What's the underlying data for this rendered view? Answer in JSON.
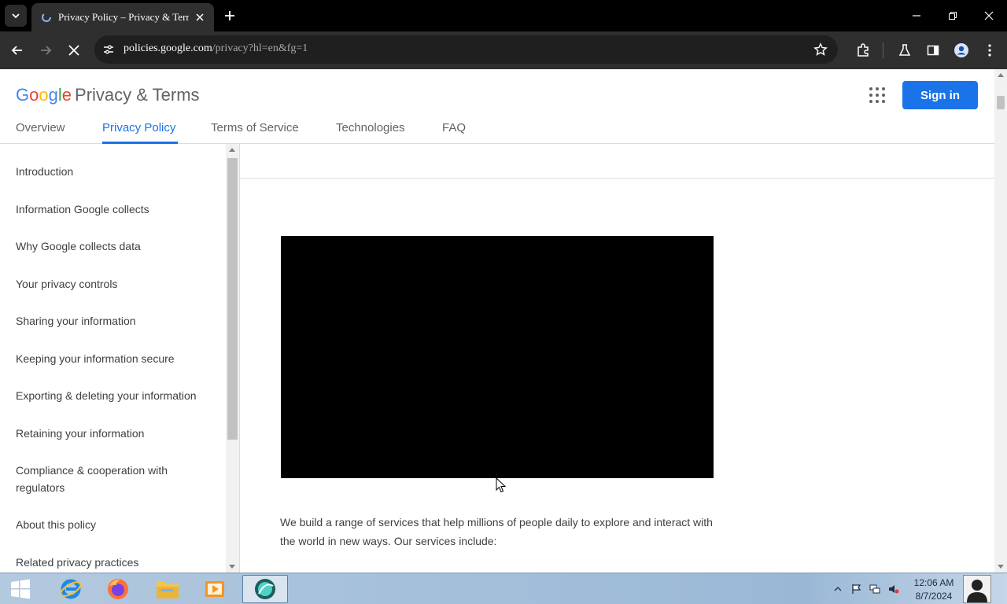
{
  "browser": {
    "tab_title": "Privacy Policy – Privacy & Terms – Google",
    "url_domain": "policies.google.com",
    "url_path": "/privacy?hl=en&fg=1"
  },
  "header": {
    "logo_letters": [
      "G",
      "o",
      "o",
      "g",
      "l",
      "e"
    ],
    "site_title": "Privacy & Terms",
    "sign_in_label": "Sign in",
    "nav_tabs": [
      {
        "label": "Overview",
        "active": false
      },
      {
        "label": "Privacy Policy",
        "active": true
      },
      {
        "label": "Terms of Service",
        "active": false
      },
      {
        "label": "Technologies",
        "active": false
      },
      {
        "label": "FAQ",
        "active": false
      }
    ]
  },
  "sidebar": {
    "items": [
      {
        "label": "Introduction"
      },
      {
        "label": "Information Google collects"
      },
      {
        "label": "Why Google collects data"
      },
      {
        "label": "Your privacy controls"
      },
      {
        "label": "Sharing your information"
      },
      {
        "label": "Keeping your information secure"
      },
      {
        "label": "Exporting & deleting your information"
      },
      {
        "label": "Retaining your information"
      },
      {
        "label": "Compliance & cooperation with regulators"
      },
      {
        "label": "About this policy"
      },
      {
        "label": "Related privacy practices"
      }
    ]
  },
  "main": {
    "intro_text": "We build a range of services that help millions of people daily to explore and interact with the world in new ways. Our services include:"
  },
  "taskbar": {
    "apps": [
      {
        "name": "start-button"
      },
      {
        "name": "internet-explorer-icon"
      },
      {
        "name": "firefox-icon"
      },
      {
        "name": "file-explorer-icon"
      },
      {
        "name": "media-player-icon"
      },
      {
        "name": "active-app-icon"
      }
    ],
    "time": "12:06 AM",
    "date": "8/7/2024"
  },
  "colors": {
    "accent": "#1a73e8",
    "text": "#3c4043",
    "chrome_dark": "#2f2f2f"
  }
}
